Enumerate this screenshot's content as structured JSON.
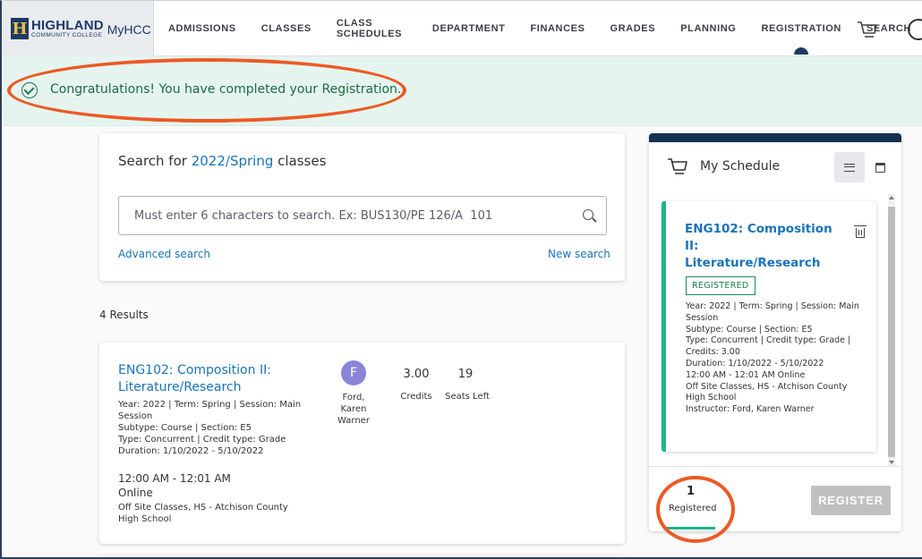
{
  "brand": {
    "name": "HIGHLAND",
    "subtitle": "COMMUNITY COLLEGE",
    "app": "MyHCC",
    "mark": "H"
  },
  "nav": {
    "items": [
      {
        "label": "ADMISSIONS"
      },
      {
        "label": "CLASSES"
      },
      {
        "label": "CLASS SCHEDULES"
      },
      {
        "label": "DEPARTMENT"
      },
      {
        "label": "FINANCES"
      },
      {
        "label": "GRADES"
      },
      {
        "label": "PLANNING"
      },
      {
        "label": "REGISTRATION"
      },
      {
        "label": "SEARCH"
      }
    ],
    "active": "REGISTRATION"
  },
  "banner": {
    "message": "Congratulations! You have completed your Registration."
  },
  "search": {
    "title_prefix": "Search for",
    "term": "2022/Spring",
    "title_suffix": "classes",
    "placeholder": "Must enter 6 characters to search. Ex: BUS130/PE 126/A  101",
    "advanced_link": "Advanced search",
    "new_link": "New search"
  },
  "results": {
    "count_label": "4 Results",
    "items": [
      {
        "title": "ENG102: Composition II: Literature/Research",
        "meta": "Year: 2022 | Term: Spring | Session: Main Session\nSubtype: Course | Section: E5\nType: Concurrent | Credit type: Grade\nDuration: 1/10/2022 - 5/10/2022",
        "time": "12:00 AM - 12:01 AM",
        "mode": "Online",
        "location": "Off Site Classes, HS - Atchison County High School",
        "instructor_initial": "F",
        "instructor_name": "Ford, Karen Warner",
        "credits": "3.00",
        "credits_label": "Credits",
        "seats": "19",
        "seats_label": "Seats Left"
      }
    ]
  },
  "schedule": {
    "title": "My Schedule",
    "course": {
      "title": "ENG102: Composition II: Literature/Research",
      "status": "REGISTERED",
      "meta": "Year: 2022 | Term: Spring | Session: Main Session\nSubtype: Course | Section: E5\nType: Concurrent | Credit type: Grade | Credits: 3.00\nDuration: 1/10/2022 - 5/10/2022\n12:00 AM - 12:01 AM Online\nOff Site Classes, HS - Atchison County High School\nInstructor: Ford, Karen Warner"
    },
    "registered_count": "1",
    "registered_label": "Registered",
    "register_button": "REGISTER"
  },
  "colors": {
    "brand_navy": "#1d3a66",
    "link_blue": "#1a73b8",
    "success_green": "#1c7a4a",
    "accent_teal": "#1fb58a",
    "annotation_orange": "#ec5a24"
  }
}
